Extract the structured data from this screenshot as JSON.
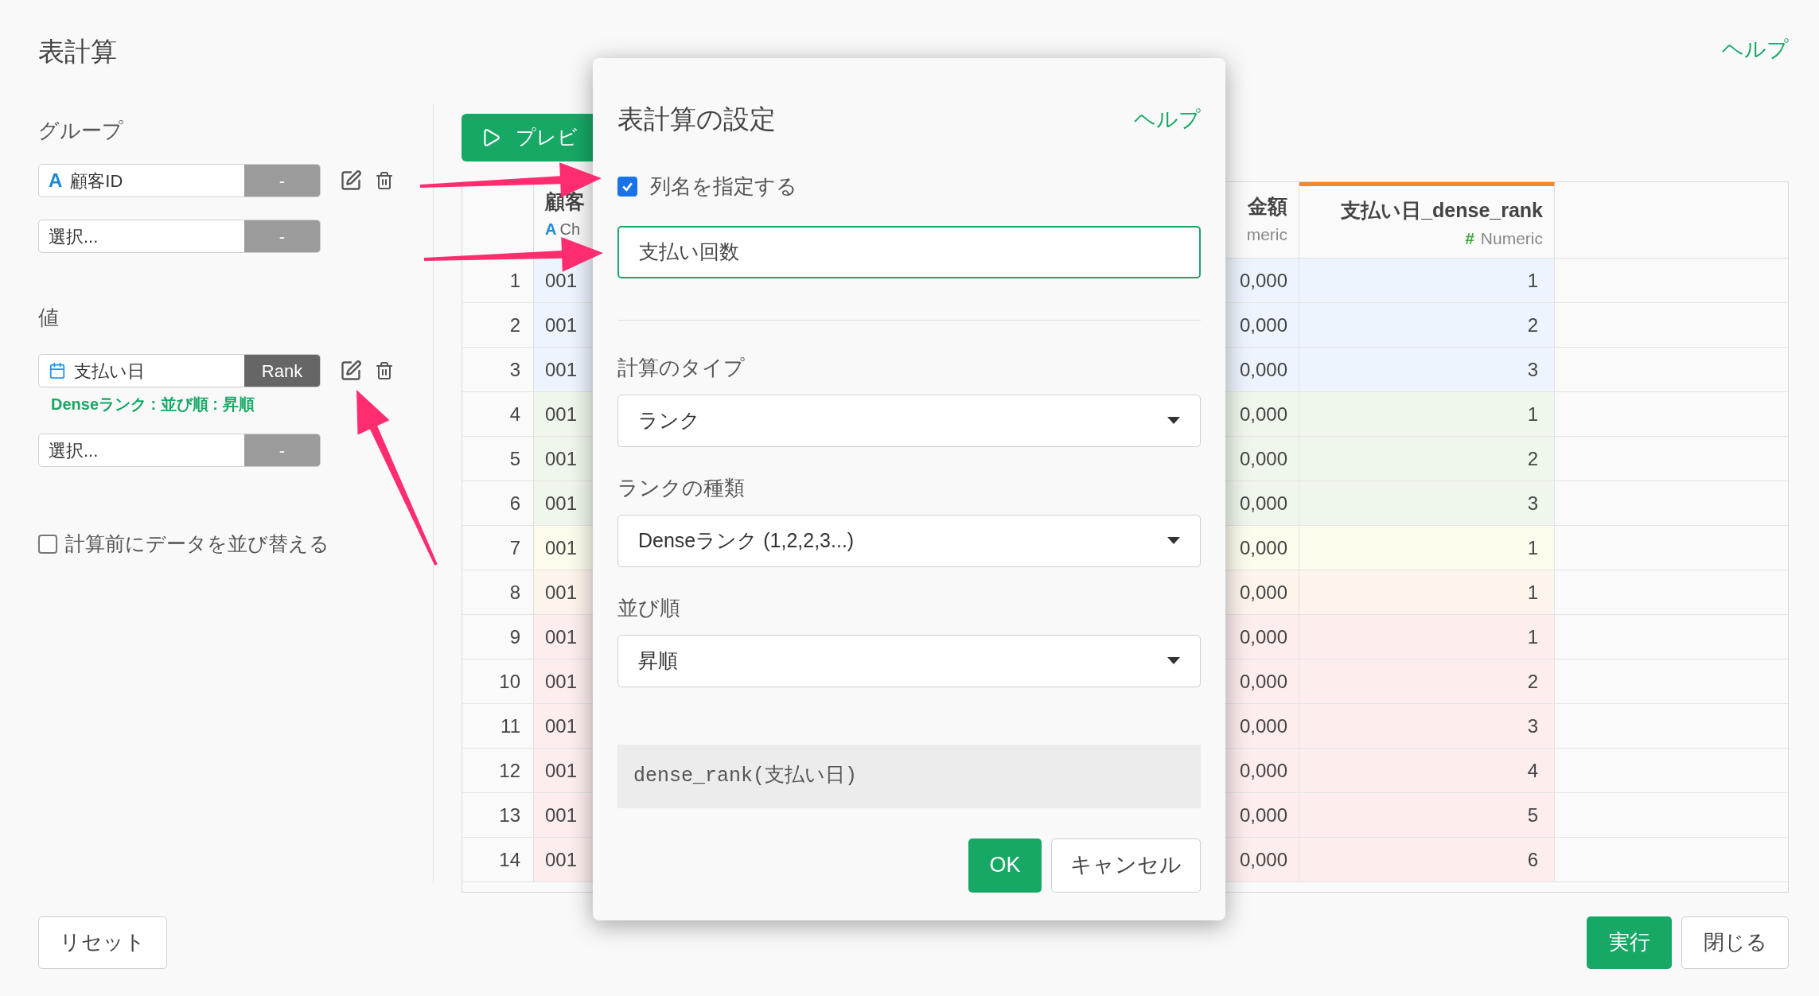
{
  "page": {
    "title": "表計算",
    "help_link": "ヘルプ"
  },
  "group": {
    "label": "グループ",
    "fields": [
      {
        "kind": "text_column",
        "type_mark": "A",
        "name": "顧客ID",
        "action": "-",
        "calculated": false
      },
      {
        "kind": "empty",
        "placeholder": "選択...",
        "action": "-"
      }
    ]
  },
  "values": {
    "label": "値",
    "fields": [
      {
        "kind": "date_column",
        "name": "支払い日",
        "action": "Rank",
        "calculated": true,
        "description": "Denseランク : 並び順 : 昇順"
      },
      {
        "kind": "empty",
        "placeholder": "選択...",
        "action": "-"
      }
    ]
  },
  "sort_before": {
    "label": "計算前にデータを並び替える",
    "checked": false
  },
  "preview_button": "プレビ",
  "table": {
    "columns": [
      {
        "kind": "text",
        "name": "顧客",
        "type_mark": "A",
        "type_label": "Ch"
      },
      {
        "kind": "numeric",
        "name": "金額",
        "type_label": "meric"
      },
      {
        "kind": "numeric",
        "name": "支払い日_dense_rank",
        "type_mark": "#",
        "type_label": "Numeric",
        "highlighted": true
      }
    ],
    "rows": [
      {
        "number": "1",
        "color": "#edf4fd",
        "cells": [
          "001",
          "0,000",
          "1"
        ]
      },
      {
        "number": "2",
        "color": "#edf4fd",
        "cells": [
          "001",
          "0,000",
          "2"
        ]
      },
      {
        "number": "3",
        "color": "#edf4fd",
        "cells": [
          "001",
          "0,000",
          "3"
        ]
      },
      {
        "number": "4",
        "color": "#eff7ec",
        "cells": [
          "001",
          "0,000",
          "1"
        ]
      },
      {
        "number": "5",
        "color": "#eff7ec",
        "cells": [
          "001",
          "0,000",
          "2"
        ]
      },
      {
        "number": "6",
        "color": "#eff7ec",
        "cells": [
          "001",
          "0,000",
          "3"
        ]
      },
      {
        "number": "7",
        "color": "#fdfbec",
        "cells": [
          "001",
          "0,000",
          "1"
        ]
      },
      {
        "number": "8",
        "color": "#fdf4ec",
        "cells": [
          "001",
          "0,000",
          "1"
        ]
      },
      {
        "number": "9",
        "color": "#fdeded",
        "cells": [
          "001",
          "0,000",
          "1"
        ]
      },
      {
        "number": "10",
        "color": "#fdeded",
        "cells": [
          "001",
          "0,000",
          "2"
        ]
      },
      {
        "number": "11",
        "color": "#fdeded",
        "cells": [
          "001",
          "0,000",
          "3"
        ]
      },
      {
        "number": "12",
        "color": "#fdeded",
        "cells": [
          "001",
          "0,000",
          "4"
        ]
      },
      {
        "number": "13",
        "color": "#fdeded",
        "cells": [
          "001",
          "0,000",
          "5"
        ]
      },
      {
        "number": "14",
        "color": "#fdeded",
        "cells": [
          "001",
          "0,000",
          "6"
        ]
      }
    ]
  },
  "dialog": {
    "title": "表計算の設定",
    "help_link": "ヘルプ",
    "name_option": {
      "label": "列名を指定する",
      "checked": true
    },
    "name_input": {
      "value": "支払い回数"
    },
    "fields": [
      {
        "label": "計算のタイプ",
        "value": "ランク"
      },
      {
        "label": "ランクの種類",
        "value": "Denseランク (1,2,2,3...)"
      },
      {
        "label": "並び順",
        "value": "昇順"
      }
    ],
    "formula": "dense_rank(支払い日)",
    "ok_button": "OK",
    "cancel_button": "キャンセル"
  },
  "footer": {
    "reset_button": "リセット",
    "run_button": "実行",
    "close_button": "閉じる"
  }
}
